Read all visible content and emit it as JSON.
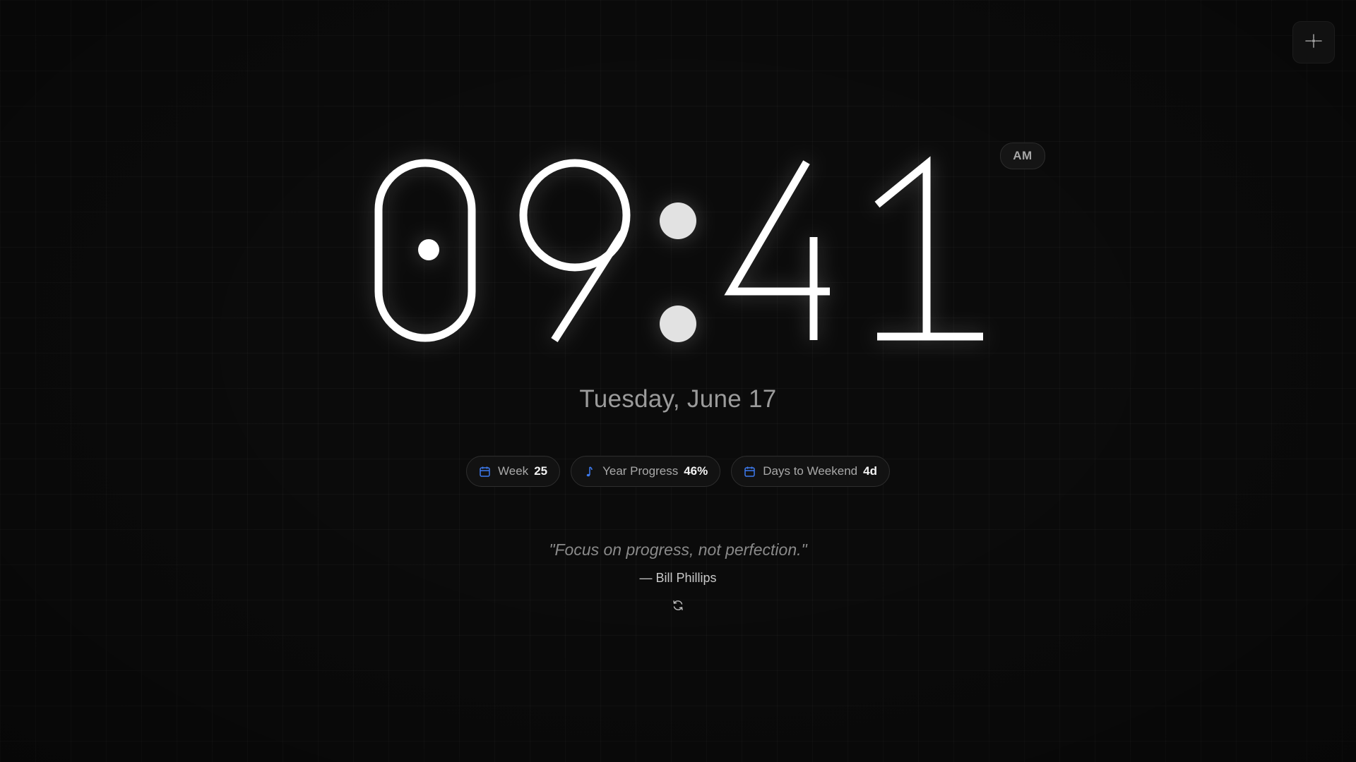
{
  "clock": {
    "hours": "09",
    "minutes": "41",
    "period": "AM"
  },
  "date_label": "Tuesday, June 17",
  "stats": [
    {
      "label": "Week",
      "value": "25",
      "icon": "calendar-icon"
    },
    {
      "label": "Year Progress",
      "value": "46%",
      "icon": "music-note-icon"
    },
    {
      "label": "Days to Weekend",
      "value": "4d",
      "icon": "calendar-icon"
    }
  ],
  "quote": {
    "text": "\"Focus on progress, not perfection.\"",
    "author": "— Bill Phillips",
    "refresh_icon": "refresh-icon"
  },
  "settings_icon": "crosshair-icon",
  "colors": {
    "background": "#0b0b0b",
    "digits": "#ffffff",
    "colon": "#e2e2e2",
    "accent_icon": "#3d7bf0"
  }
}
